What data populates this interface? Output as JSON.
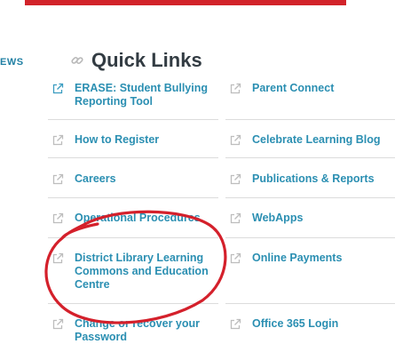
{
  "nav": {
    "side_tab": "EWS"
  },
  "section": {
    "title": "Quick Links",
    "title_icon": "link-icon"
  },
  "link_icon": "external-link-icon",
  "colors": {
    "accent_red": "#d2232a",
    "link": "#2b8fb2",
    "heading": "#333c43",
    "annotation": "#d4202b"
  },
  "links_left": [
    {
      "label": "ERASE: Student Bullying Reporting Tool"
    },
    {
      "label": "How to Register"
    },
    {
      "label": "Careers"
    },
    {
      "label": "Operational Procedures"
    },
    {
      "label": "District Library Learning Commons and Education Centre"
    },
    {
      "label": "Change or recover your Password"
    }
  ],
  "links_right": [
    {
      "label": "Parent Connect"
    },
    {
      "label": "Celebrate Learning Blog"
    },
    {
      "label": "Publications & Reports"
    },
    {
      "label": "WebApps"
    },
    {
      "label": "Online Payments"
    },
    {
      "label": "Office 365 Login"
    }
  ]
}
